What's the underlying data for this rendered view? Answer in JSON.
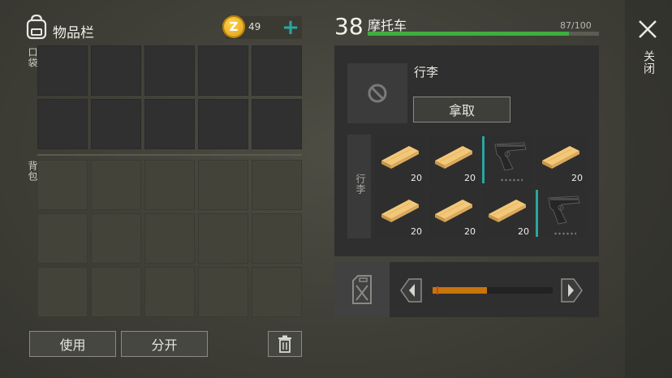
{
  "inventory": {
    "title": "物品栏",
    "pocket_label": "口袋",
    "backpack_label": "背包",
    "coins": "49",
    "use_label": "使用",
    "split_label": "分开"
  },
  "vehicle": {
    "level": "38",
    "name": "摩托车",
    "durability_text": "87/100",
    "durability": 0.87,
    "luggage_title": "行李",
    "take_label": "拿取",
    "luggage_side_label": "行李",
    "fuel_level": 0.45
  },
  "close_label": "关闭",
  "loot": [
    {
      "item": "wood-plank",
      "count": "20"
    },
    {
      "item": "wood-plank",
      "count": "20"
    },
    {
      "item": "pistol",
      "count": ""
    },
    {
      "item": "wood-plank",
      "count": "20"
    },
    {
      "item": "wood-plank",
      "count": "20"
    },
    {
      "item": "wood-plank",
      "count": "20"
    },
    {
      "item": "wood-plank",
      "count": "20"
    },
    {
      "item": "pistol",
      "count": ""
    }
  ],
  "colors": {
    "accent": "#2aa6a0",
    "health": "#3fae3f",
    "fuel": "#c8750c"
  }
}
